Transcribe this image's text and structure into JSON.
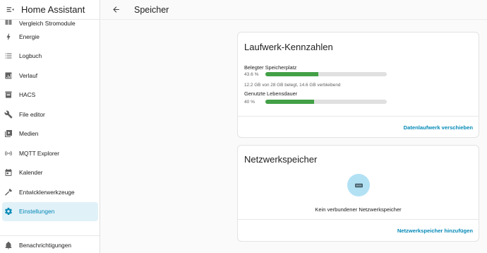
{
  "app": {
    "title": "Home Assistant"
  },
  "header": {
    "title": "Speicher"
  },
  "sidebar": {
    "items": [
      {
        "label": "Vergleich Stromodule",
        "icon": "compare-icon",
        "active": false
      },
      {
        "label": "Energie",
        "icon": "lightning-icon",
        "active": false
      },
      {
        "label": "Logbuch",
        "icon": "list-icon",
        "active": false
      },
      {
        "label": "Verlauf",
        "icon": "chart-icon",
        "active": false
      },
      {
        "label": "HACS",
        "icon": "store-icon",
        "active": false
      },
      {
        "label": "File editor",
        "icon": "wrench-icon",
        "active": false
      },
      {
        "label": "Medien",
        "icon": "play-box-icon",
        "active": false
      },
      {
        "label": "MQTT Explorer",
        "icon": "antenna-icon",
        "active": false
      },
      {
        "label": "Kalender",
        "icon": "calendar-icon",
        "active": false
      },
      {
        "label": "Entwicklerwerkzeuge",
        "icon": "hammer-icon",
        "active": false
      },
      {
        "label": "Einstellungen",
        "icon": "gear-icon",
        "active": true
      }
    ],
    "bottom": {
      "label": "Benachrichtigungen",
      "icon": "bell-icon"
    }
  },
  "storage_card": {
    "title": "Laufwerk-Kennzahlen",
    "used_space": {
      "label": "Belegter Speicherplatz",
      "percent_text": "43.6 %",
      "percent": 43.6,
      "detail": "12.2 GB von 28 GB belegt, 14.6 GB verbleibend"
    },
    "lifetime": {
      "label": "Genutzte Lebensdauer",
      "percent_text": "40 %",
      "percent": 40
    },
    "action": "Datenlaufwerk verschieben"
  },
  "network_card": {
    "title": "Netzwerkspeicher",
    "icon": "nas-icon",
    "empty_text": "Kein verbundener Netzwerkspeicher",
    "action": "Netzwerkspeicher hinzufügen"
  },
  "colors": {
    "accent": "#0389b7",
    "bar_fill": "#43a047",
    "bar_track": "#e0e0e0",
    "active_bg": "#e1f1f8",
    "icon_circle": "#b2e1f4"
  }
}
